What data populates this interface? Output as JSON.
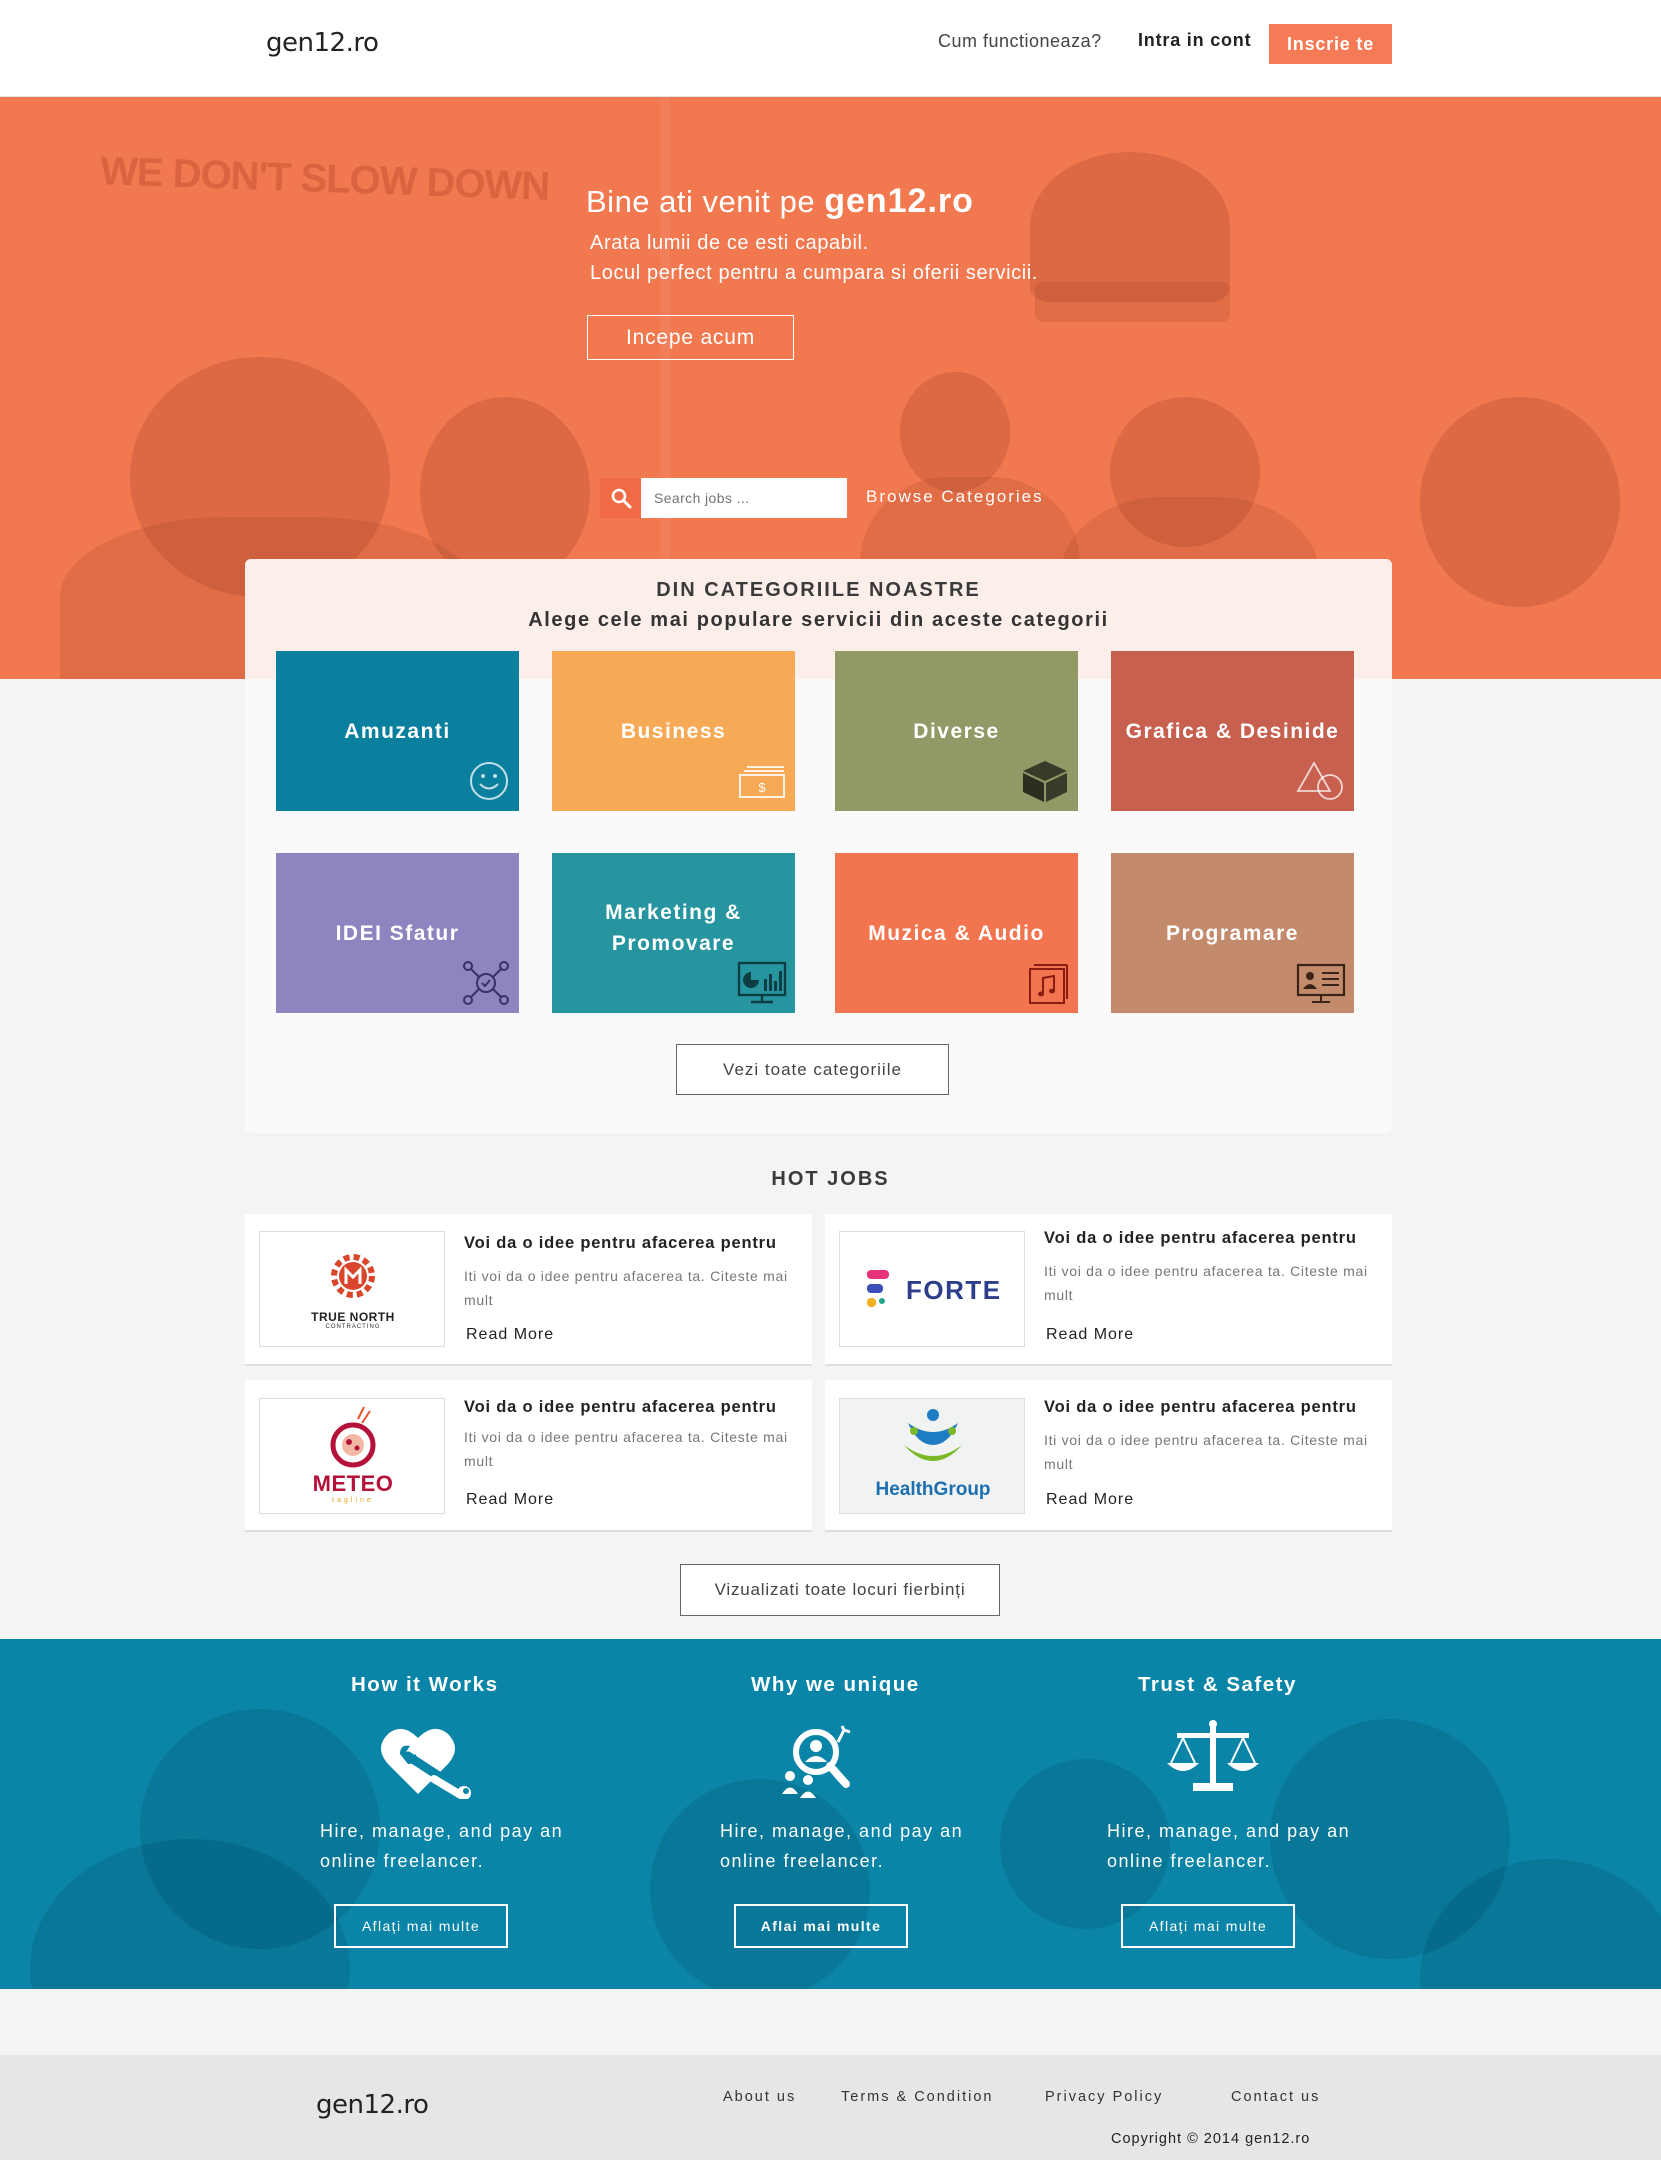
{
  "header": {
    "logo": "gen12.ro",
    "nav_how": "Cum functioneaza?",
    "nav_login": "Intra in cont",
    "nav_signup": "Inscrie te"
  },
  "hero": {
    "title_prefix": "Bine ati venit pe ",
    "title_brand": "gen12.ro",
    "line1": "Arata lumii de ce esti capabil.",
    "line2": "Locul perfect pentru a cumpara si oferii servicii.",
    "cta": "Incepe acum",
    "background_slogan": "WE DON'T SLOW DOWN",
    "search_placeholder": "Search jobs ...",
    "browse": "Browse Categories"
  },
  "categories": {
    "title": "DIN CATEGORIILE NOASTRE",
    "subtitle": "Alege cele mai populare servicii din aceste categorii",
    "items": [
      {
        "label": "Amuzanti",
        "color": "#0b7f9e",
        "icon": "smiley-icon"
      },
      {
        "label": "Business",
        "color": "#f6aa55",
        "icon": "money-icon"
      },
      {
        "label": "Diverse",
        "color": "#929966",
        "icon": "box-icon"
      },
      {
        "label": "Grafica & Desinide",
        "color": "#c86050",
        "icon": "shapes-icon"
      },
      {
        "label": "IDEI Sfatur",
        "color": "#8d84c0",
        "icon": "network-icon"
      },
      {
        "label": "Marketing & Promovare",
        "color": "#2695a0",
        "icon": "analytics-monitor-icon"
      },
      {
        "label": "Muzica  & Audio",
        "color": "#f2754f",
        "icon": "music-note-icon"
      },
      {
        "label": "Programare",
        "color": "#c48a6c",
        "icon": "id-card-icon"
      }
    ],
    "see_all": "Vezi toate categoriile"
  },
  "hot_jobs": {
    "title": "HOT JOBS",
    "items": [
      {
        "title": "Voi da o idee pentru afacerea pentru",
        "desc": "Iti voi da o idee pentru afacerea ta. Citeste mai mult",
        "read_more": "Read More",
        "logo_text": "TRUE NORTH",
        "logo_sub": "CONTRACTING"
      },
      {
        "title": "Voi da o idee pentru afacerea pentru",
        "desc": "Iti voi da o idee pentru afacerea ta. Citeste mai mult",
        "read_more": "Read More",
        "logo_text": "FORTE",
        "logo_sub": ""
      },
      {
        "title": "Voi da o idee pentru afacerea pentru",
        "desc": "Iti voi da o idee pentru afacerea ta. Citeste mai mult",
        "read_more": "Read More",
        "logo_text": "METEO",
        "logo_sub": "tagline"
      },
      {
        "title": "Voi da o idee pentru afacerea pentru",
        "desc": "Iti voi da o idee pentru afacerea ta. Citeste mai mult",
        "read_more": "Read More",
        "logo_text": "HealthGroup",
        "logo_sub": ""
      }
    ],
    "see_all": "Vizualizati toate locuri fierbinți"
  },
  "features": [
    {
      "title": "How it Works",
      "desc": "Hire, manage, and pay an online freelancer.",
      "button": "Aflați mai multe",
      "icon": "heart-wrench-icon"
    },
    {
      "title": "Why we unique",
      "desc": "Hire, manage, and pay an online freelancer.",
      "button": "Aflai mai multe",
      "icon": "people-search-icon"
    },
    {
      "title": "Trust & Safety",
      "desc": "Hire, manage, and pay an online freelancer.",
      "button": "Aflați mai multe",
      "icon": "scales-icon"
    }
  ],
  "footer": {
    "logo": "gen12.ro",
    "links": [
      "About us",
      "Terms & Condition",
      "Privacy Policy",
      "Contact us"
    ],
    "copyright": "Copyright © 2014 gen12.ro"
  },
  "colors": {
    "accent": "#f47b55",
    "hero_bg": "#f2784f",
    "features_bg": "#0a85a8"
  }
}
